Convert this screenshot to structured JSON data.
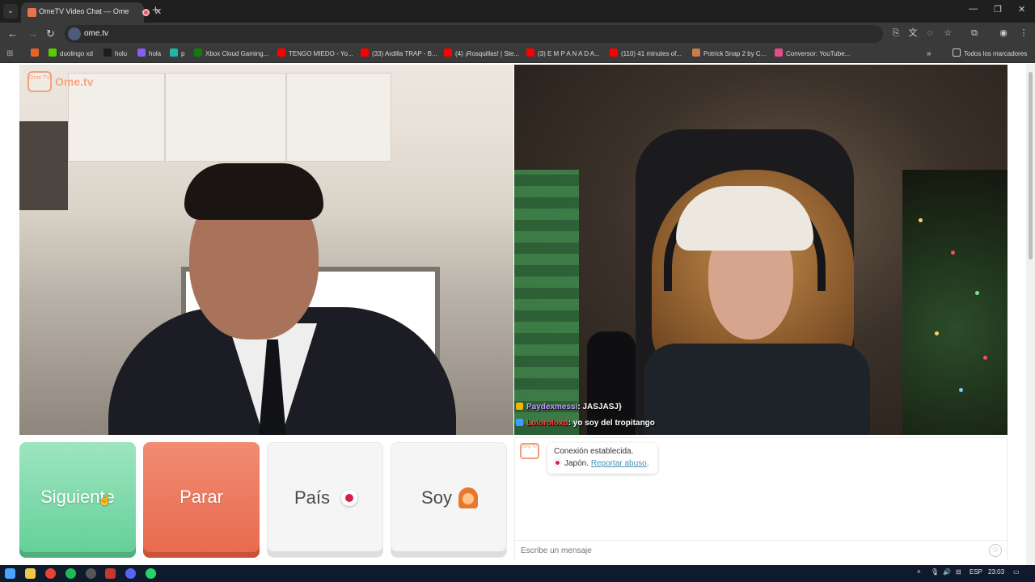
{
  "browser": {
    "tab_title": "OmeTV Video Chat — Ome",
    "url": "ome.tv",
    "bookmarks": [
      {
        "label": "",
        "color": "#e8632a"
      },
      {
        "label": "duolingo xd",
        "color": "#58cc02"
      },
      {
        "label": "holu",
        "color": "#1d1d1d"
      },
      {
        "label": "hola",
        "color": "#8a5cf6"
      },
      {
        "label": "p",
        "color": "#1fb5a8"
      },
      {
        "label": "Xbox Cloud Gaming...",
        "color": "#107c10"
      },
      {
        "label": "TENGO MIEDO - Yo...",
        "color": "#ff0000"
      },
      {
        "label": "(33) Ardilla TRAP - B...",
        "color": "#ff0000"
      },
      {
        "label": "(4) ¡Rosquillas! | Ste...",
        "color": "#ff0000"
      },
      {
        "label": "(3) E M P A N A D A...",
        "color": "#ff0000"
      },
      {
        "label": "(110) 41 minutes of...",
        "color": "#ff0000"
      },
      {
        "label": "Potrick Snap 2 by C...",
        "color": "#c97b4a"
      },
      {
        "label": "Conversor: YouTube...",
        "color": "#e04f8a"
      }
    ],
    "all_bookmarks": "Todos los marcadores"
  },
  "app": {
    "logo_badge": "Ome TV",
    "logo_text": "Ome.tv"
  },
  "chat_overlay": [
    {
      "user": "Paydexmessi",
      "text": ": JASJASJ}",
      "badge_color": "#f5b400"
    },
    {
      "user": "Loloroloxd",
      "text": ": yo soy del tropitango",
      "badge_color": "#3aa0ff"
    }
  ],
  "buttons": {
    "next": "Siguiente",
    "stop": "Parar",
    "country": "País",
    "gender": "Soy"
  },
  "chat": {
    "logo": "Ome TV",
    "connected": "Conexión establecida.",
    "country": "Japón.",
    "report": "Reportar abuso",
    "period": ".",
    "placeholder": "Escribe un mensaje"
  },
  "taskbar": {
    "language": "ESP",
    "time": "23:03"
  }
}
